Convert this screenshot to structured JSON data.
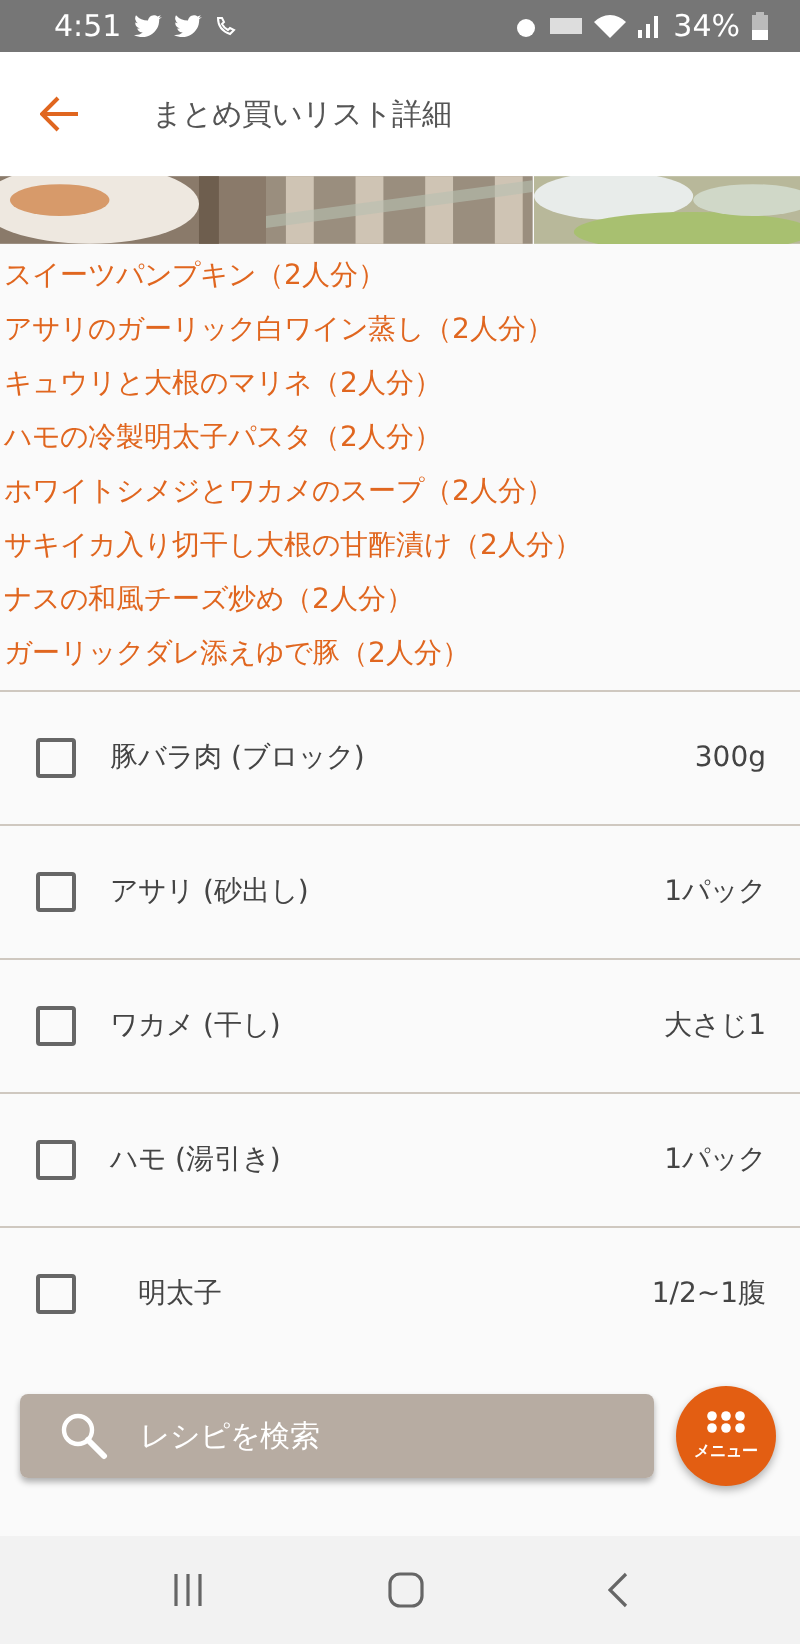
{
  "status_bar": {
    "time": "4:51",
    "battery": "34%"
  },
  "header": {
    "title": "まとめ買いリスト詳細"
  },
  "recipes": [
    "スイーツパンプキン（2人分）",
    "アサリのガーリック白ワイン蒸し（2人分）",
    "キュウリと大根のマリネ（2人分）",
    "ハモの冷製明太子パスタ（2人分）",
    "ホワイトシメジとワカメのスープ（2人分）",
    "サキイカ入り切干し大根の甘酢漬け（2人分）",
    "ナスの和風チーズ炒め（2人分）",
    "ガーリックダレ添えゆで豚（2人分）"
  ],
  "ingredients": [
    {
      "name": "豚バラ肉 (ブロック)",
      "amount": "300g",
      "checked": false
    },
    {
      "name": "アサリ (砂出し)",
      "amount": "1パック",
      "checked": false
    },
    {
      "name": "ワカメ (干し)",
      "amount": "大さじ1",
      "checked": false
    },
    {
      "name": "ハモ (湯引き)",
      "amount": "1パック",
      "checked": false
    },
    {
      "name": "　明太子",
      "amount": "1/2~1腹",
      "checked": false
    }
  ],
  "search": {
    "placeholder": "レシピを検索"
  },
  "menu_button": {
    "label": "メニュー"
  }
}
